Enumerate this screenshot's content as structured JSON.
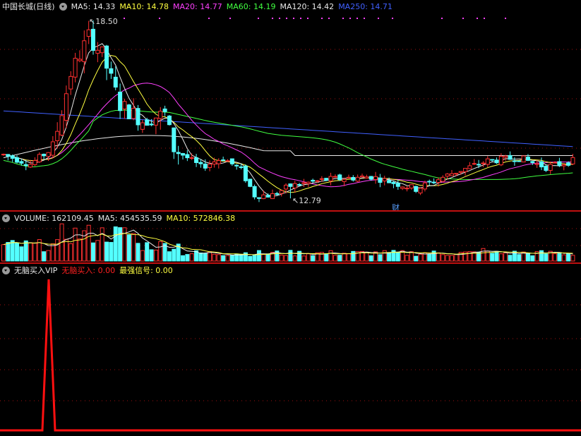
{
  "price_pane": {
    "stock_name": "中国长城(日线)",
    "ma": [
      {
        "label": "MA5:",
        "value": "14.33",
        "color": "#e8e8e8"
      },
      {
        "label": "MA10:",
        "value": "14.78",
        "color": "#ffff40"
      },
      {
        "label": "MA20:",
        "value": "14.77",
        "color": "#ff40ff"
      },
      {
        "label": "MA60:",
        "value": "14.19",
        "color": "#40ff40"
      },
      {
        "label": "MA120:",
        "value": "14.42",
        "color": "#e8e8e8"
      },
      {
        "label": "MA250:",
        "value": "14.71",
        "color": "#4060ff"
      }
    ],
    "high_label": "18.50",
    "low_label": "12.79",
    "marker_label": "财"
  },
  "volume_pane": {
    "items": [
      {
        "label": "VOLUME:",
        "value": "162109.45",
        "color": "#e8e8e8"
      },
      {
        "label": "MA5:",
        "value": "454535.59",
        "color": "#e8e8e8"
      },
      {
        "label": "MA10:",
        "value": "572846.38",
        "color": "#ffff40"
      }
    ]
  },
  "indicator_pane": {
    "name": "无脑买入VIP",
    "items": [
      {
        "label": "无脑买入:",
        "value": "0.00",
        "color": "#ff2020"
      },
      {
        "label": "最强信号:",
        "value": "0.00",
        "color": "#ffff40"
      }
    ]
  },
  "colors": {
    "up": "#ff3030",
    "down": "#54ffff",
    "ma5": "#e8e8e8",
    "ma10": "#ffff40",
    "ma20": "#ff40ff",
    "ma60": "#40ff40",
    "ma120": "#e8e8e8",
    "ma250": "#4060ff",
    "signal": "#ff1010",
    "grid": "#a01010"
  }
}
